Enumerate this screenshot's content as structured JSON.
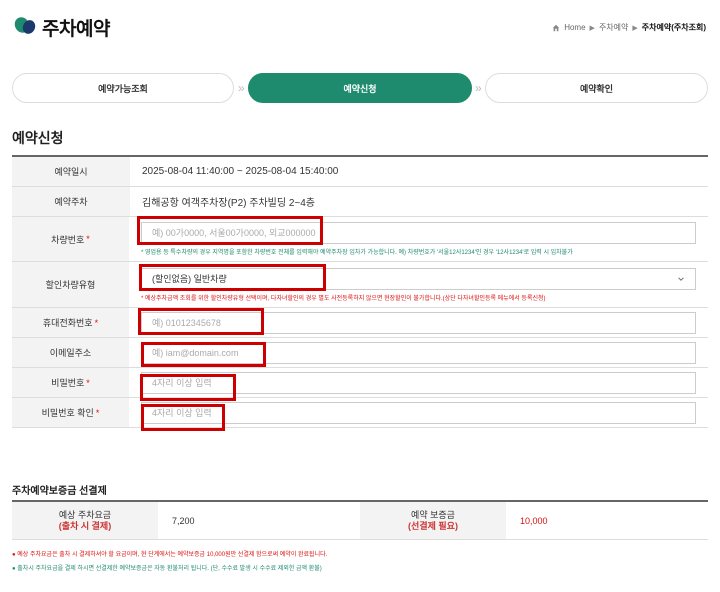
{
  "header": {
    "title": "주차예약",
    "breadcrumb": [
      "Home",
      "주차예약",
      "주차예약(주차조회)"
    ]
  },
  "steps": [
    {
      "label": "예약가능조회",
      "active": false
    },
    {
      "label": "예약신청",
      "active": true
    },
    {
      "label": "예약확인",
      "active": false
    }
  ],
  "form": {
    "title": "예약신청",
    "reservation_datetime": {
      "label": "예약일시",
      "value": "2025-08-04 11:40:00 ~ 2025-08-04 15:40:00"
    },
    "parking_lot": {
      "label": "예약주차",
      "value": "김해공항 여객주차장(P2) 주차빌딩 2~4층"
    },
    "vehicle_number": {
      "label": "차량번호",
      "required": "*",
      "placeholder": "예) 00가0000, 서울00가0000, 외교000000",
      "note": "* 영업용 등 특수차량의 경우 지역명을 포함한 차량번호 전체를 입력해야 예약주차장 입차가 가능합니다. 예) 차량번호가 '서울12사1234'인 경우 '12사1234'로 입력 시 입차불가"
    },
    "discount_type": {
      "label": "할인차량유형",
      "value": "(할인없음) 일반차량",
      "note": "* 예상주차금액 조회를 위한 할인차량유형 선택이며, 다자녀할인의 경우 별도 사전등록하지 않으면 현장할인이 불가합니다.(상단 다자녀할인등록 메뉴에서 등록신청)"
    },
    "phone": {
      "label": "휴대전화번호",
      "required": "*",
      "placeholder": "예) 01012345678"
    },
    "email": {
      "label": "이메일주소",
      "placeholder": "예) iam@domain.com"
    },
    "password": {
      "label": "비밀번호",
      "required": "*",
      "placeholder": "4자리 이상 입력"
    },
    "password_confirm": {
      "label": "비밀번호 확인",
      "required": "*",
      "placeholder": "4자리 이상 입력"
    }
  },
  "fees": {
    "title": "주차예약보증금 선결제",
    "expected_fee_label": "예상 주차요금",
    "expected_fee_sub": "(출차 시 결제)",
    "expected_fee_value": "7,200",
    "deposit_label": "예약 보증금",
    "deposit_sub": "(선결제 필요)",
    "deposit_value": "10,000"
  },
  "footnotes": [
    "● 예상 주차요금은 출차 시 결제하셔야 할 요금이며, 현 단계에서는 예약보증금 10,000원만 선결제 함으로써 예약이 완료됩니다.",
    "● 출차시 주차요금을 결제 하시면 선결제한 예약보증금은 자동 환불처리 됩니다. (단, 수수료 발생 시 수수료 제외한 금액 환불)"
  ],
  "colors": {
    "accent": "#1e8a6e",
    "required": "#dd1111",
    "highlight": "#cc0000"
  }
}
